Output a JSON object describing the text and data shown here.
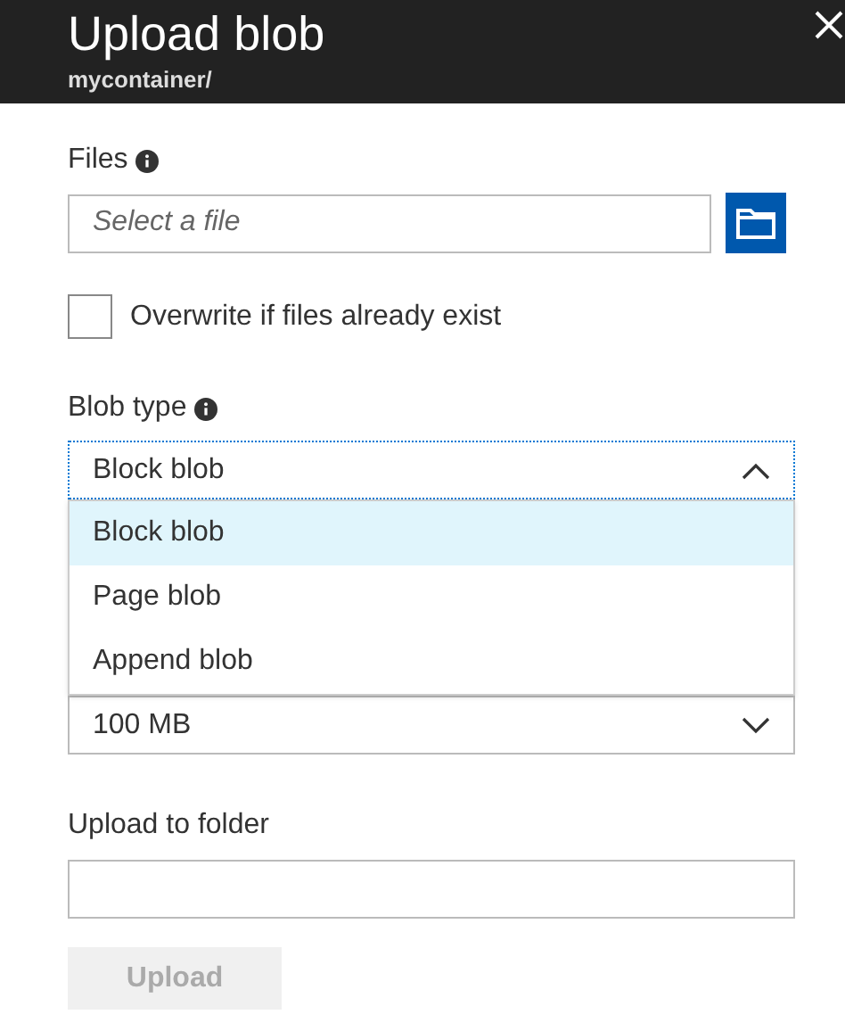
{
  "header": {
    "title": "Upload blob",
    "subtitle": "mycontainer/"
  },
  "files": {
    "label": "Files",
    "placeholder": "Select a file"
  },
  "overwrite": {
    "label": "Overwrite if files already exist",
    "checked": false
  },
  "blob_type": {
    "label": "Blob type",
    "value": "Block blob",
    "expanded": true,
    "options": [
      {
        "label": "Block blob",
        "selected": true
      },
      {
        "label": "Page blob",
        "selected": false
      },
      {
        "label": "Append blob",
        "selected": false
      }
    ]
  },
  "block_size": {
    "value": "100 MB",
    "expanded": false
  },
  "folder": {
    "label": "Upload to folder"
  },
  "upload_button": {
    "label": "Upload",
    "disabled": true
  }
}
